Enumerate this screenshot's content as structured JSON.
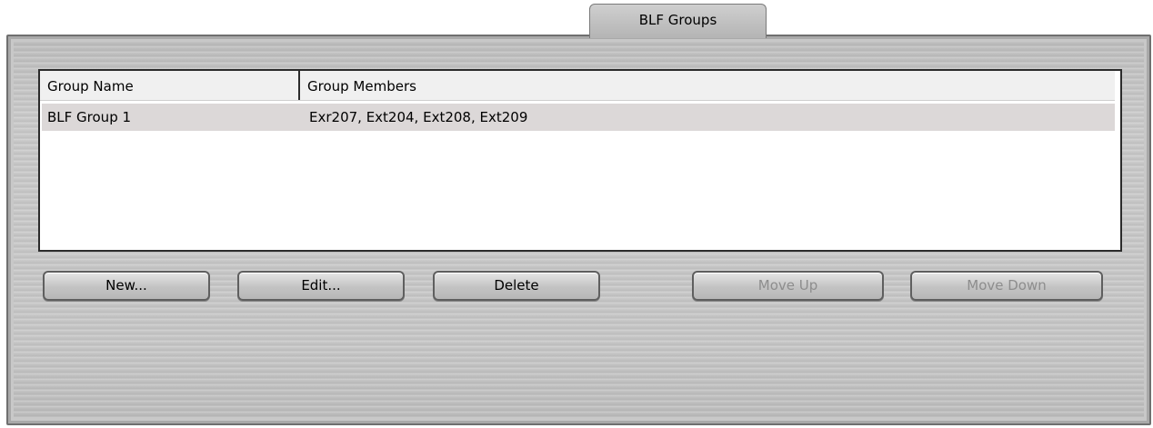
{
  "tab": {
    "label": "BLF Groups"
  },
  "table": {
    "columns": [
      "Group Name",
      "Group Members"
    ],
    "rows": [
      {
        "name": "BLF Group 1",
        "members": "Exr207, Ext204, Ext208, Ext209"
      }
    ]
  },
  "buttons": {
    "new": "New...",
    "edit": "Edit...",
    "delete": "Delete",
    "move_up": "Move Up",
    "move_down": "Move Down"
  }
}
